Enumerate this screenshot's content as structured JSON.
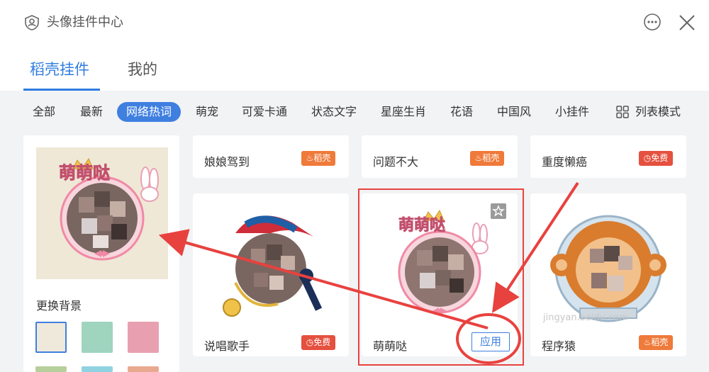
{
  "window": {
    "title": "头像挂件中心"
  },
  "tabs": [
    {
      "label": "稻壳挂件"
    },
    {
      "label": "我的"
    }
  ],
  "categories": [
    "全部",
    "最新",
    "网络热词",
    "萌宠",
    "可爱卡通",
    "状态文字",
    "星座生肖",
    "花语",
    "中国风",
    "小挂件"
  ],
  "active_category": "网络热词",
  "list_mode_label": "列表模式",
  "preview": {
    "background_label": "更换背景",
    "sticker_text": "萌萌哒",
    "swatch_colors": [
      "#efe9dc",
      "#9fd4bf",
      "#e8a0b0"
    ]
  },
  "text_cards": [
    {
      "name": "娘娘驾到",
      "badge": "稻壳"
    },
    {
      "name": "问题不大",
      "badge": "稻壳"
    },
    {
      "name": "重度懒癌",
      "badge": "免费"
    }
  ],
  "pendant_cards": [
    {
      "name": "说唱歌手",
      "badge": "免费"
    },
    {
      "name": "萌萌哒",
      "apply_label": "应用",
      "sticker_text": "萌萌哒"
    },
    {
      "name": "程序猿",
      "badge": "稻壳"
    }
  ],
  "colors": {
    "accent": "#2f7de1",
    "badge_paid": "#ef7a3a",
    "badge_free": "#e5503f",
    "annotation": "#e8423f"
  },
  "watermark": "jingyan.baidu.com"
}
